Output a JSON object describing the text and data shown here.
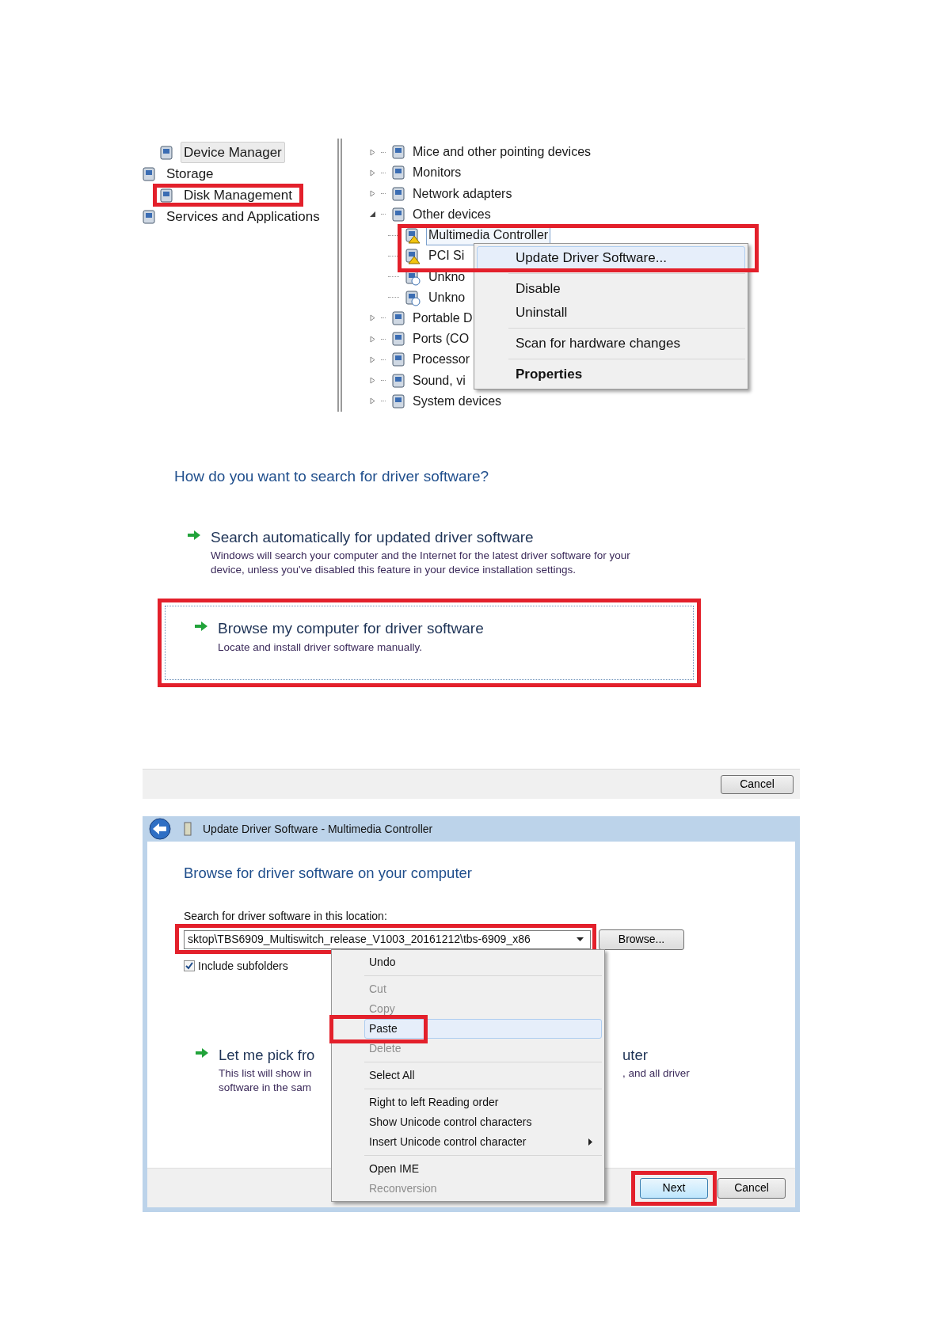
{
  "device_manager": {
    "nav": [
      {
        "label": "Device Manager",
        "selected": true
      },
      {
        "label": "Storage",
        "selected": false,
        "children": [
          {
            "label": "Disk Management",
            "selected": false
          }
        ]
      },
      {
        "label": "Services and Applications",
        "selected": false
      }
    ],
    "tree": [
      {
        "label": "Mice and other pointing devices",
        "expanded": false
      },
      {
        "label": "Monitors",
        "expanded": false
      },
      {
        "label": "Network adapters",
        "expanded": false
      },
      {
        "label": "Other devices",
        "expanded": true,
        "children": [
          {
            "label": "Multimedia Controller",
            "kind": "warning",
            "selected": true
          },
          {
            "label": "PCI Si",
            "kind": "warning",
            "selected": false
          },
          {
            "label": "Unkno",
            "kind": "unknown",
            "selected": false
          },
          {
            "label": "Unkno",
            "kind": "unknown",
            "selected": false
          }
        ]
      },
      {
        "label": "Portable D",
        "expanded": false
      },
      {
        "label": "Ports (CO",
        "expanded": false
      },
      {
        "label": "Processor",
        "expanded": false
      },
      {
        "label": "Sound, vi",
        "expanded": false
      },
      {
        "label": "System devices",
        "expanded": false
      }
    ],
    "context_menu": [
      [
        {
          "label": "Update Driver Software...",
          "selected": true,
          "bold": false
        }
      ],
      [
        {
          "label": "Disable",
          "selected": false,
          "bold": false
        },
        {
          "label": "Uninstall",
          "selected": false,
          "bold": false
        }
      ],
      [
        {
          "label": "Scan for hardware changes",
          "selected": false,
          "bold": false
        }
      ],
      [
        {
          "label": "Properties",
          "selected": false,
          "bold": true
        }
      ]
    ]
  },
  "search_choice": {
    "heading": "How do you want to search for driver software?",
    "options": [
      {
        "title": "Search automatically for updated driver software",
        "description": "Windows will search your computer and the Internet for the latest driver software for your device, unless you've disabled this feature in your device installation settings.",
        "focused": false
      },
      {
        "title": "Browse my computer for driver software",
        "description": "Locate and install driver software manually.",
        "focused": true
      }
    ]
  },
  "top_strip": {
    "button": "Cancel"
  },
  "browse_dialog": {
    "title": "Update Driver Software - Multimedia Controller",
    "heading": "Browse for driver software on your computer",
    "location_label": "Search for driver software in this location:",
    "location_value": "sktop\\TBS6909_Multiswitch_release_V1003_20161212\\tbs-6909_x86",
    "browse_button": "Browse...",
    "include_subfolders": {
      "label": "Include subfolders",
      "checked": true
    },
    "pick_option": {
      "title_left": "Let me pick fro",
      "title_right": "uter",
      "description_left": [
        "This list will show in",
        "software in the sam"
      ],
      "description_right": [
        ", and all driver"
      ]
    },
    "context_menu": [
      [
        {
          "label": "Undo",
          "disabled": false,
          "selected": false,
          "submenu": false
        }
      ],
      [
        {
          "label": "Cut",
          "disabled": true,
          "selected": false,
          "submenu": false
        },
        {
          "label": "Copy",
          "disabled": true,
          "selected": false,
          "submenu": false
        },
        {
          "label": "Paste",
          "disabled": false,
          "selected": true,
          "submenu": false
        },
        {
          "label": "Delete",
          "disabled": true,
          "selected": false,
          "submenu": false
        }
      ],
      [
        {
          "label": "Select All",
          "disabled": false,
          "selected": false,
          "submenu": false
        }
      ],
      [
        {
          "label": "Right to left Reading order",
          "disabled": false,
          "selected": false,
          "submenu": false
        },
        {
          "label": "Show Unicode control characters",
          "disabled": false,
          "selected": false,
          "submenu": false
        },
        {
          "label": "Insert Unicode control character",
          "disabled": false,
          "selected": false,
          "submenu": true
        }
      ],
      [
        {
          "label": "Open IME",
          "disabled": false,
          "selected": false,
          "submenu": false
        },
        {
          "label": "Reconversion",
          "disabled": true,
          "selected": false,
          "submenu": false
        }
      ]
    ],
    "buttons": [
      {
        "label": "Next",
        "default": true
      },
      {
        "label": "Cancel",
        "default": false
      }
    ]
  }
}
